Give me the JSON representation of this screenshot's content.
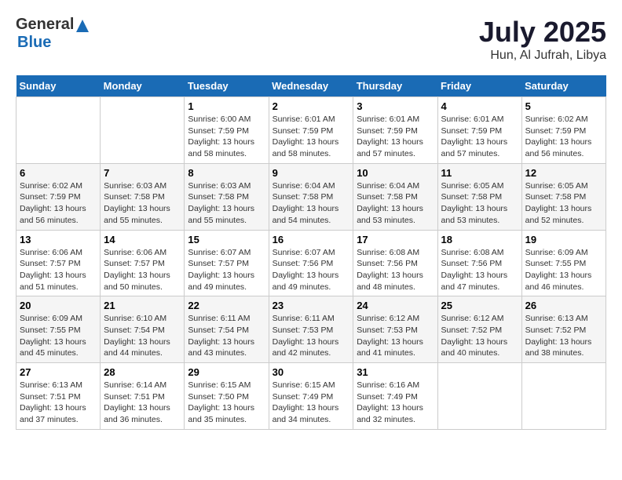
{
  "header": {
    "logo_general": "General",
    "logo_blue": "Blue",
    "title": "July 2025",
    "location": "Hun, Al Jufrah, Libya"
  },
  "weekdays": [
    "Sunday",
    "Monday",
    "Tuesday",
    "Wednesday",
    "Thursday",
    "Friday",
    "Saturday"
  ],
  "weeks": [
    [
      {
        "day": null
      },
      {
        "day": null
      },
      {
        "day": 1,
        "sunrise": "6:00 AM",
        "sunset": "7:59 PM",
        "daylight": "13 hours and 58 minutes."
      },
      {
        "day": 2,
        "sunrise": "6:01 AM",
        "sunset": "7:59 PM",
        "daylight": "13 hours and 58 minutes."
      },
      {
        "day": 3,
        "sunrise": "6:01 AM",
        "sunset": "7:59 PM",
        "daylight": "13 hours and 57 minutes."
      },
      {
        "day": 4,
        "sunrise": "6:01 AM",
        "sunset": "7:59 PM",
        "daylight": "13 hours and 57 minutes."
      },
      {
        "day": 5,
        "sunrise": "6:02 AM",
        "sunset": "7:59 PM",
        "daylight": "13 hours and 56 minutes."
      }
    ],
    [
      {
        "day": 6,
        "sunrise": "6:02 AM",
        "sunset": "7:59 PM",
        "daylight": "13 hours and 56 minutes."
      },
      {
        "day": 7,
        "sunrise": "6:03 AM",
        "sunset": "7:58 PM",
        "daylight": "13 hours and 55 minutes."
      },
      {
        "day": 8,
        "sunrise": "6:03 AM",
        "sunset": "7:58 PM",
        "daylight": "13 hours and 55 minutes."
      },
      {
        "day": 9,
        "sunrise": "6:04 AM",
        "sunset": "7:58 PM",
        "daylight": "13 hours and 54 minutes."
      },
      {
        "day": 10,
        "sunrise": "6:04 AM",
        "sunset": "7:58 PM",
        "daylight": "13 hours and 53 minutes."
      },
      {
        "day": 11,
        "sunrise": "6:05 AM",
        "sunset": "7:58 PM",
        "daylight": "13 hours and 53 minutes."
      },
      {
        "day": 12,
        "sunrise": "6:05 AM",
        "sunset": "7:58 PM",
        "daylight": "13 hours and 52 minutes."
      }
    ],
    [
      {
        "day": 13,
        "sunrise": "6:06 AM",
        "sunset": "7:57 PM",
        "daylight": "13 hours and 51 minutes."
      },
      {
        "day": 14,
        "sunrise": "6:06 AM",
        "sunset": "7:57 PM",
        "daylight": "13 hours and 50 minutes."
      },
      {
        "day": 15,
        "sunrise": "6:07 AM",
        "sunset": "7:57 PM",
        "daylight": "13 hours and 49 minutes."
      },
      {
        "day": 16,
        "sunrise": "6:07 AM",
        "sunset": "7:56 PM",
        "daylight": "13 hours and 49 minutes."
      },
      {
        "day": 17,
        "sunrise": "6:08 AM",
        "sunset": "7:56 PM",
        "daylight": "13 hours and 48 minutes."
      },
      {
        "day": 18,
        "sunrise": "6:08 AM",
        "sunset": "7:56 PM",
        "daylight": "13 hours and 47 minutes."
      },
      {
        "day": 19,
        "sunrise": "6:09 AM",
        "sunset": "7:55 PM",
        "daylight": "13 hours and 46 minutes."
      }
    ],
    [
      {
        "day": 20,
        "sunrise": "6:09 AM",
        "sunset": "7:55 PM",
        "daylight": "13 hours and 45 minutes."
      },
      {
        "day": 21,
        "sunrise": "6:10 AM",
        "sunset": "7:54 PM",
        "daylight": "13 hours and 44 minutes."
      },
      {
        "day": 22,
        "sunrise": "6:11 AM",
        "sunset": "7:54 PM",
        "daylight": "13 hours and 43 minutes."
      },
      {
        "day": 23,
        "sunrise": "6:11 AM",
        "sunset": "7:53 PM",
        "daylight": "13 hours and 42 minutes."
      },
      {
        "day": 24,
        "sunrise": "6:12 AM",
        "sunset": "7:53 PM",
        "daylight": "13 hours and 41 minutes."
      },
      {
        "day": 25,
        "sunrise": "6:12 AM",
        "sunset": "7:52 PM",
        "daylight": "13 hours and 40 minutes."
      },
      {
        "day": 26,
        "sunrise": "6:13 AM",
        "sunset": "7:52 PM",
        "daylight": "13 hours and 38 minutes."
      }
    ],
    [
      {
        "day": 27,
        "sunrise": "6:13 AM",
        "sunset": "7:51 PM",
        "daylight": "13 hours and 37 minutes."
      },
      {
        "day": 28,
        "sunrise": "6:14 AM",
        "sunset": "7:51 PM",
        "daylight": "13 hours and 36 minutes."
      },
      {
        "day": 29,
        "sunrise": "6:15 AM",
        "sunset": "7:50 PM",
        "daylight": "13 hours and 35 minutes."
      },
      {
        "day": 30,
        "sunrise": "6:15 AM",
        "sunset": "7:49 PM",
        "daylight": "13 hours and 34 minutes."
      },
      {
        "day": 31,
        "sunrise": "6:16 AM",
        "sunset": "7:49 PM",
        "daylight": "13 hours and 32 minutes."
      },
      {
        "day": null
      },
      {
        "day": null
      }
    ]
  ],
  "labels": {
    "sunrise": "Sunrise:",
    "sunset": "Sunset:",
    "daylight": "Daylight:"
  }
}
